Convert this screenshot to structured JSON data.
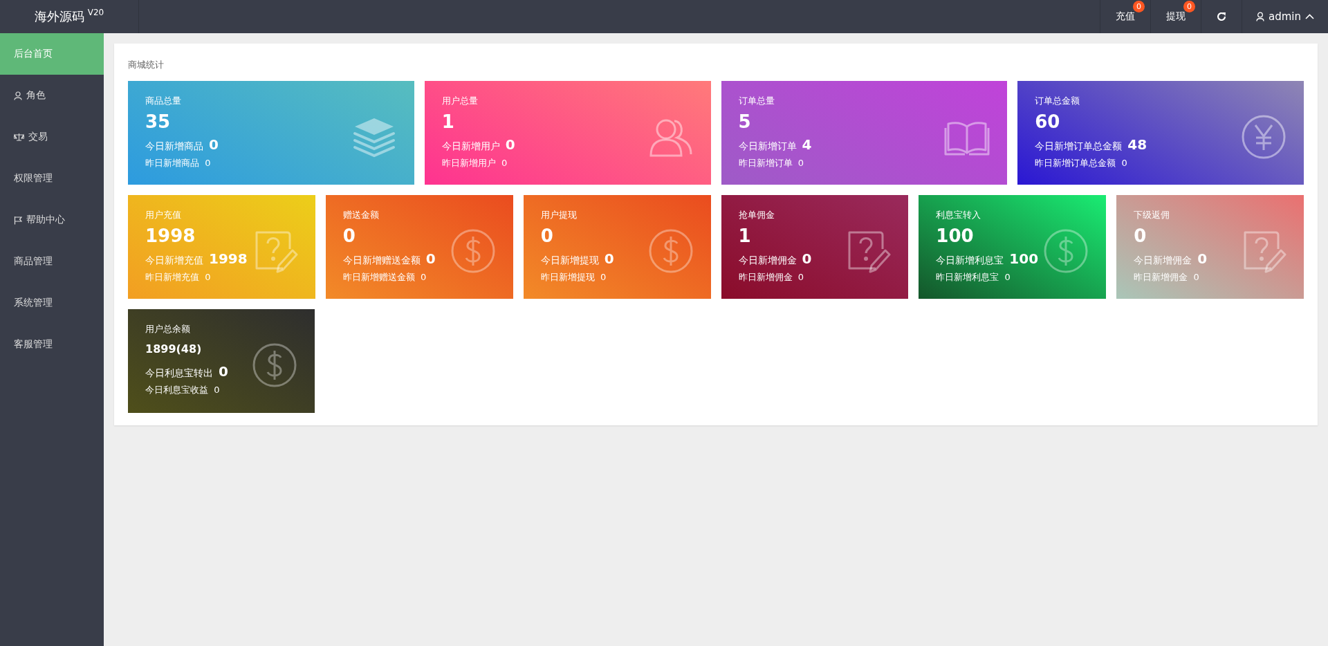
{
  "header": {
    "logo": "海外源码",
    "version": "V20",
    "actions": [
      {
        "kind": "badge",
        "label": "充值",
        "count": "0"
      },
      {
        "kind": "badge",
        "label": "提现",
        "count": "0"
      },
      {
        "kind": "refresh"
      }
    ],
    "user": "admin"
  },
  "sidebar": {
    "items": [
      {
        "label": "后台首页",
        "kind": "plain",
        "selected": true
      },
      {
        "label": "角色",
        "kind": "user",
        "selected": false
      },
      {
        "label": "交易",
        "kind": "scale",
        "selected": false
      },
      {
        "label": "权限管理",
        "kind": "plain",
        "selected": false
      },
      {
        "label": "帮助中心",
        "kind": "flag",
        "selected": false
      },
      {
        "label": "商品管理",
        "kind": "plain",
        "selected": false
      },
      {
        "label": "系统管理",
        "kind": "plain",
        "selected": false
      },
      {
        "label": "客服管理",
        "kind": "plain",
        "selected": false
      }
    ]
  },
  "panel": {
    "title": "商城统计",
    "summary_cards": [
      {
        "kind": "layers",
        "color": "#2d9bdf",
        "title": "商品总量",
        "value": "35",
        "today_label": "今日新增商品",
        "today_value": "0",
        "yesterday": "昨日新增商品  0"
      },
      {
        "kind": "users",
        "color": "#fe3390",
        "title": "用户总量",
        "value": "1",
        "today_label": "今日新增用户",
        "today_value": "0",
        "yesterday": "昨日新增用户  0"
      },
      {
        "kind": "book",
        "color": "#9e5bc7",
        "title": "订单总量",
        "value": "5",
        "today_label": "今日新增订单",
        "today_value": "4",
        "yesterday": "昨日新增订单  0"
      },
      {
        "kind": "yen",
        "color": "#2a17d3",
        "title": "订单总金额",
        "value": "60",
        "today_label": "今日新增订单总金额",
        "today_value": "48",
        "yesterday": "昨日新增订单总金额  0"
      }
    ],
    "finance_cards": [
      {
        "kind": "note",
        "color": "#f29e22",
        "title": "用户充值",
        "value": "1998",
        "today_label": "今日新增充值",
        "today_value": "1998",
        "yesterday": "昨日新增充值  0"
      },
      {
        "kind": "dollar",
        "color": "#f28a28",
        "title": "赠送金额",
        "value": "0",
        "today_label": "今日新增赠送金额",
        "today_value": "0",
        "yesterday": "昨日新增赠送金额  0"
      },
      {
        "kind": "dollar",
        "color": "#f28a28",
        "title": "用户提现",
        "value": "0",
        "today_label": "今日新增提现",
        "today_value": "0",
        "yesterday": "昨日新增提现  0"
      },
      {
        "kind": "note",
        "color": "#8a0c2a",
        "title": "抢单佣金",
        "value": "1",
        "today_label": "今日新增佣金",
        "today_value": "0",
        "yesterday": "昨日新增佣金  0"
      },
      {
        "kind": "dollar",
        "color": "#14562a",
        "title": "利息宝转入",
        "value": "100",
        "today_label": "今日新增利息宝",
        "today_value": "100",
        "yesterday": "昨日新增利息宝  0"
      },
      {
        "kind": "note",
        "color": "#a9c6b8",
        "title": "下级返佣",
        "value": "0",
        "today_label": "今日新增佣金",
        "today_value": "0",
        "yesterday": "昨日新增佣金  0"
      }
    ],
    "balance_card": {
      "kind": "dollar",
      "color": "#4f4f1a",
      "title": "用户总余额",
      "value": "1899(48)",
      "today_label": "今日利息宝转出",
      "today_value": "0",
      "yesterday": "今日利息宝收益  0"
    }
  }
}
